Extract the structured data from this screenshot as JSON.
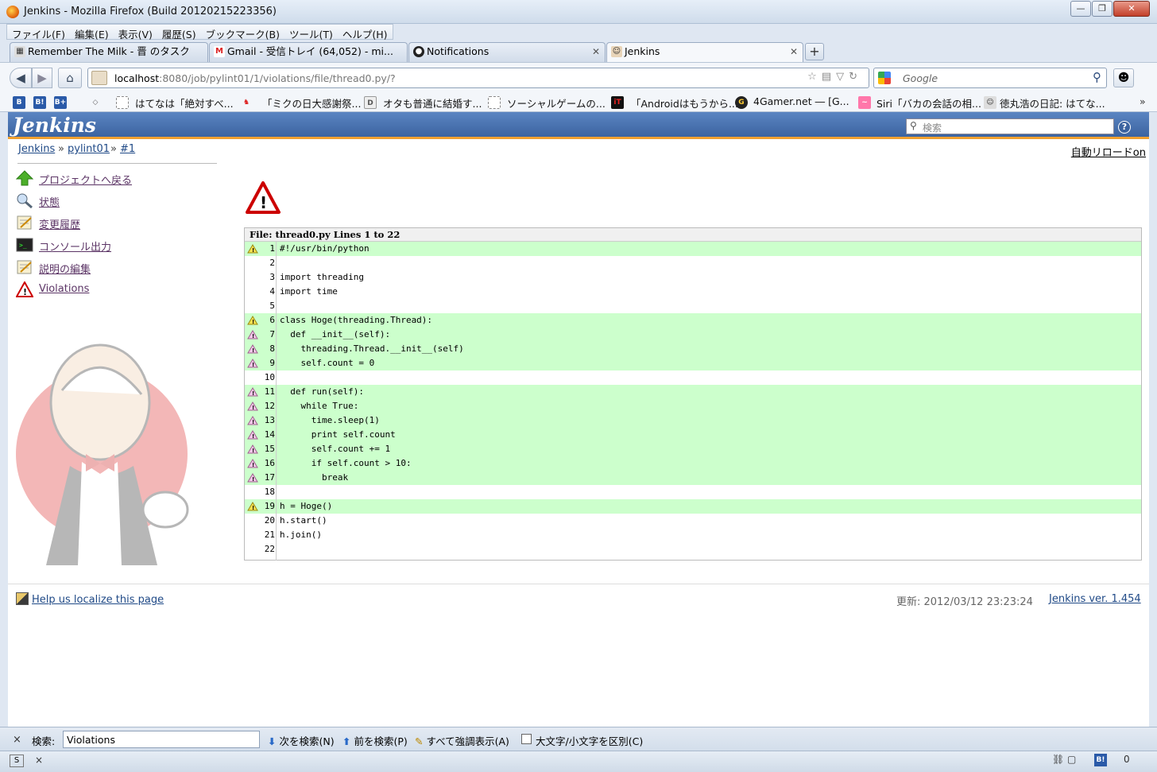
{
  "window": {
    "title": "Jenkins - Mozilla Firefox (Build 20120215223356)"
  },
  "menu": [
    "ファイル(F)",
    "編集(E)",
    "表示(V)",
    "履歴(S)",
    "ブックマーク(B)",
    "ツール(T)",
    "ヘルプ(H)"
  ],
  "tabs": [
    {
      "label": "Remember The Milk - 晋 のタスク",
      "icon": "rtm-icon"
    },
    {
      "label": "Gmail - 受信トレイ (64,052) - mi...",
      "icon": "gmail-icon"
    },
    {
      "label": "Notifications",
      "icon": "github-icon"
    },
    {
      "label": "Jenkins",
      "icon": "jenkins-icon",
      "active": true
    }
  ],
  "address": {
    "host": "localhost",
    "path": ":8080/job/pylint01/1/violations/file/thread0.py/?"
  },
  "search": {
    "placeholder": "Google"
  },
  "bookmarks": [
    "はてなは「絶対すべ...",
    "「ミクの日大感謝祭...",
    "オタも普通に結婚す...",
    "ソーシャルゲームの...",
    "「Androidはもうから...",
    "4Gamer.net ― [G...",
    "Siri「バカの会話の相...",
    "徳丸浩の日記: はてな..."
  ],
  "jenkins": {
    "logo": "Jenkins",
    "search_placeholder": "検索",
    "help": "?",
    "breadcrumb": [
      "Jenkins",
      "pylint01",
      "#1"
    ],
    "breadcrumb_sep": "»",
    "autoreload": "自動リロードon",
    "sidebar": [
      {
        "label": "プロジェクトへ戻る",
        "icon": "up-arrow-icon"
      },
      {
        "label": "状態",
        "icon": "magnifier-icon"
      },
      {
        "label": "変更履歴",
        "icon": "notepad-icon"
      },
      {
        "label": "コンソール出力",
        "icon": "terminal-icon"
      },
      {
        "label": "説明の編集",
        "icon": "notepad-icon"
      },
      {
        "label": "Violations",
        "icon": "warning-icon"
      }
    ],
    "file_header": "File: thread0.py Lines 1 to 22",
    "lines": [
      {
        "n": "1",
        "code": "#!/usr/bin/python",
        "violation": true,
        "severity": "yellow"
      },
      {
        "n": "2",
        "code": "",
        "violation": false
      },
      {
        "n": "3",
        "code": "import threading",
        "violation": false
      },
      {
        "n": "4",
        "code": "import time",
        "violation": false
      },
      {
        "n": "5",
        "code": "",
        "violation": false
      },
      {
        "n": "6",
        "code": "class Hoge(threading.Thread):",
        "violation": true,
        "severity": "yellow"
      },
      {
        "n": "7",
        "code": "  def __init__(self):",
        "violation": true,
        "severity": "pink"
      },
      {
        "n": "8",
        "code": "    threading.Thread.__init__(self)",
        "violation": true,
        "severity": "pink"
      },
      {
        "n": "9",
        "code": "    self.count = 0",
        "violation": true,
        "severity": "pink"
      },
      {
        "n": "10",
        "code": "",
        "violation": false
      },
      {
        "n": "11",
        "code": "  def run(self):",
        "violation": true,
        "severity": "pink"
      },
      {
        "n": "12",
        "code": "    while True:",
        "violation": true,
        "severity": "pink"
      },
      {
        "n": "13",
        "code": "      time.sleep(1)",
        "violation": true,
        "severity": "pink"
      },
      {
        "n": "14",
        "code": "      print self.count",
        "violation": true,
        "severity": "pink"
      },
      {
        "n": "15",
        "code": "      self.count += 1",
        "violation": true,
        "severity": "pink"
      },
      {
        "n": "16",
        "code": "      if self.count > 10:",
        "violation": true,
        "severity": "pink"
      },
      {
        "n": "17",
        "code": "        break",
        "violation": true,
        "severity": "pink"
      },
      {
        "n": "18",
        "code": "",
        "violation": false
      },
      {
        "n": "19",
        "code": "h = Hoge()",
        "violation": true,
        "severity": "yellow"
      },
      {
        "n": "20",
        "code": "h.start()",
        "violation": false
      },
      {
        "n": "21",
        "code": "h.join()",
        "violation": false
      },
      {
        "n": "22",
        "code": "",
        "violation": false
      }
    ],
    "footer": {
      "localize": "Help us localize this page",
      "updated": "更新: 2012/03/12 23:23:24",
      "version": "Jenkins ver. 1.454"
    }
  },
  "findbar": {
    "close": "×",
    "label": "検索:",
    "value": "Violations",
    "next": "次を検索(N)",
    "prev": "前を検索(P)",
    "highlight": "すべて強調表示(A)",
    "case": "大文字/小文字を区別(C)"
  },
  "statusbar": {
    "close": "×",
    "count": "0"
  },
  "colors": {
    "violation_bg": "#ccffcc",
    "header": "#3b63a0",
    "accent": "#f0a030"
  }
}
